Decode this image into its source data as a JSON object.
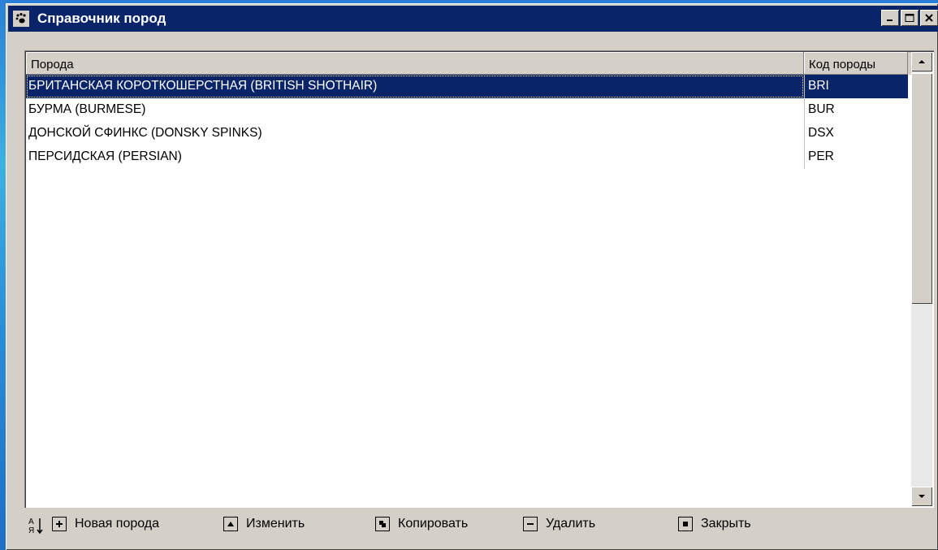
{
  "window": {
    "title": "Справочник пород",
    "icon": "paw-icon"
  },
  "table": {
    "columns": [
      "Порода",
      "Код породы"
    ],
    "rows": [
      {
        "breed": "БРИТАНСКАЯ КОРОТКОШЕРСТНАЯ (BRITISH SHOTHAIR)",
        "code": "BRI",
        "selected": true
      },
      {
        "breed": "БУРМА (BURMESE)",
        "code": "BUR",
        "selected": false
      },
      {
        "breed": "ДОНСКОЙ СФИНКС (DONSKY SPINKS)",
        "code": "DSX",
        "selected": false
      },
      {
        "breed": "ПЕРСИДСКАЯ (PERSIAN)",
        "code": "PER",
        "selected": false
      }
    ]
  },
  "toolbar": {
    "sort_icon": "sort-az-icon",
    "new_label": "Новая порода",
    "edit_label": "Изменить",
    "copy_label": "Копировать",
    "delete_label": "Удалить",
    "close_label": "Закрыть"
  },
  "colors": {
    "titlebar": "#0a246a",
    "selection": "#0a246a",
    "face": "#d4d0c8"
  }
}
